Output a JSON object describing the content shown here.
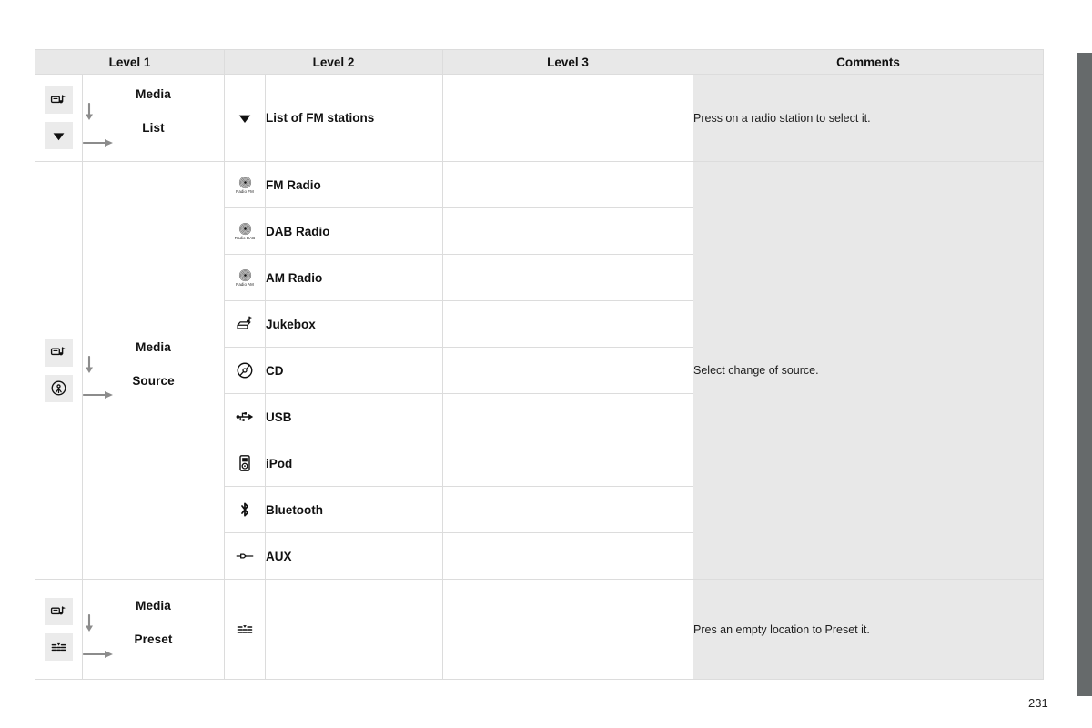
{
  "document": {
    "page_number": "231"
  },
  "table": {
    "headers": [
      "Level 1",
      "Level 2",
      "Level 3",
      "Comments"
    ],
    "groups": [
      {
        "id": "media-list",
        "level1": {
          "icons": [
            "media-icon",
            "list-triangle-icon"
          ],
          "from": "Media",
          "to": "List"
        },
        "comment": "Press on a radio station to select it.",
        "rows": [
          {
            "icon": "list-triangle-icon",
            "icon_caption": "",
            "label": "List of FM stations",
            "level3": ""
          }
        ]
      },
      {
        "id": "media-source",
        "level1": {
          "icons": [
            "media-icon",
            "source-antenna-icon"
          ],
          "from": "Media",
          "to": "Source"
        },
        "comment": "Select change of source.",
        "rows": [
          {
            "icon": "radio-dial-icon",
            "icon_caption": "Radio FM",
            "label": "FM Radio",
            "level3": ""
          },
          {
            "icon": "radio-dial-icon",
            "icon_caption": "Radio DAB",
            "label": "DAB Radio",
            "level3": ""
          },
          {
            "icon": "radio-dial-icon",
            "icon_caption": "Radio AM",
            "label": "AM Radio",
            "level3": ""
          },
          {
            "icon": "jukebox-icon",
            "icon_caption": "",
            "label": "Jukebox",
            "level3": ""
          },
          {
            "icon": "cd-icon",
            "icon_caption": "",
            "label": "CD",
            "level3": ""
          },
          {
            "icon": "usb-icon",
            "icon_caption": "",
            "label": "USB",
            "level3": ""
          },
          {
            "icon": "ipod-icon",
            "icon_caption": "",
            "label": "iPod",
            "level3": ""
          },
          {
            "icon": "bluetooth-icon",
            "icon_caption": "",
            "label": "Bluetooth",
            "level3": ""
          },
          {
            "icon": "aux-jack-icon",
            "icon_caption": "",
            "label": "AUX",
            "level3": ""
          }
        ]
      },
      {
        "id": "media-preset",
        "level1": {
          "icons": [
            "media-icon",
            "preset-list-icon"
          ],
          "from": "Media",
          "to": "Preset"
        },
        "comment": "Pres an empty location to Preset it.",
        "rows": [
          {
            "icon": "preset-list-icon",
            "icon_caption": "",
            "label": "",
            "level3": ""
          }
        ]
      }
    ]
  },
  "colors": {
    "header_bg": "#e8e8e8",
    "comment_bg": "#e8e8e8",
    "grid_line": "#dcdcdc",
    "icon_chip_bg": "#ebebeb",
    "edge_bar": "#666a6b",
    "arrow": "#8c8c8c"
  }
}
